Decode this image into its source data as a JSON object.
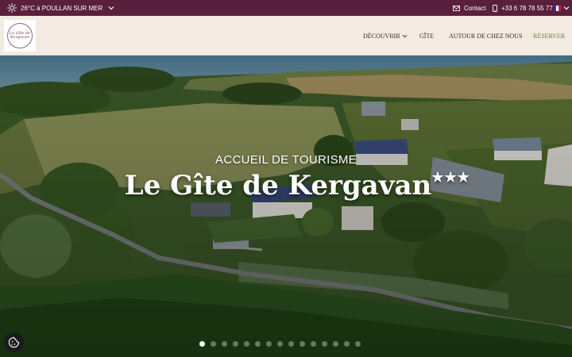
{
  "topbar": {
    "weather_text": "26°C à POULLAN SUR MER",
    "contact_label": "Contact",
    "phone_text": "+33 6 78 78 55 77",
    "language_flag": "fr-flag-icon"
  },
  "header": {
    "logo_text": "Le Gîte de Kergavan",
    "nav": {
      "decouvrir": "DÉCOUVRIR",
      "gite": "GÎTE",
      "autour": "AUTOUR DE CHEZ NOUS",
      "reserver": "RÉSERVER"
    }
  },
  "hero": {
    "subtitle": "ACCUEIL DE TOURISME",
    "title": "Le Gîte de Kergavan",
    "stars": "★★★",
    "slide_count": 15,
    "active_slide": 1
  },
  "colors": {
    "topbar_bg": "#5a1f3c",
    "header_bg": "#f3ebe2",
    "nav_text": "#3c1a2c",
    "reserver_text": "#6a7a3a"
  },
  "icons": {
    "weather": "sun-icon",
    "contact": "mail-icon",
    "phone": "phone-icon",
    "cookie": "cookie-icon"
  }
}
